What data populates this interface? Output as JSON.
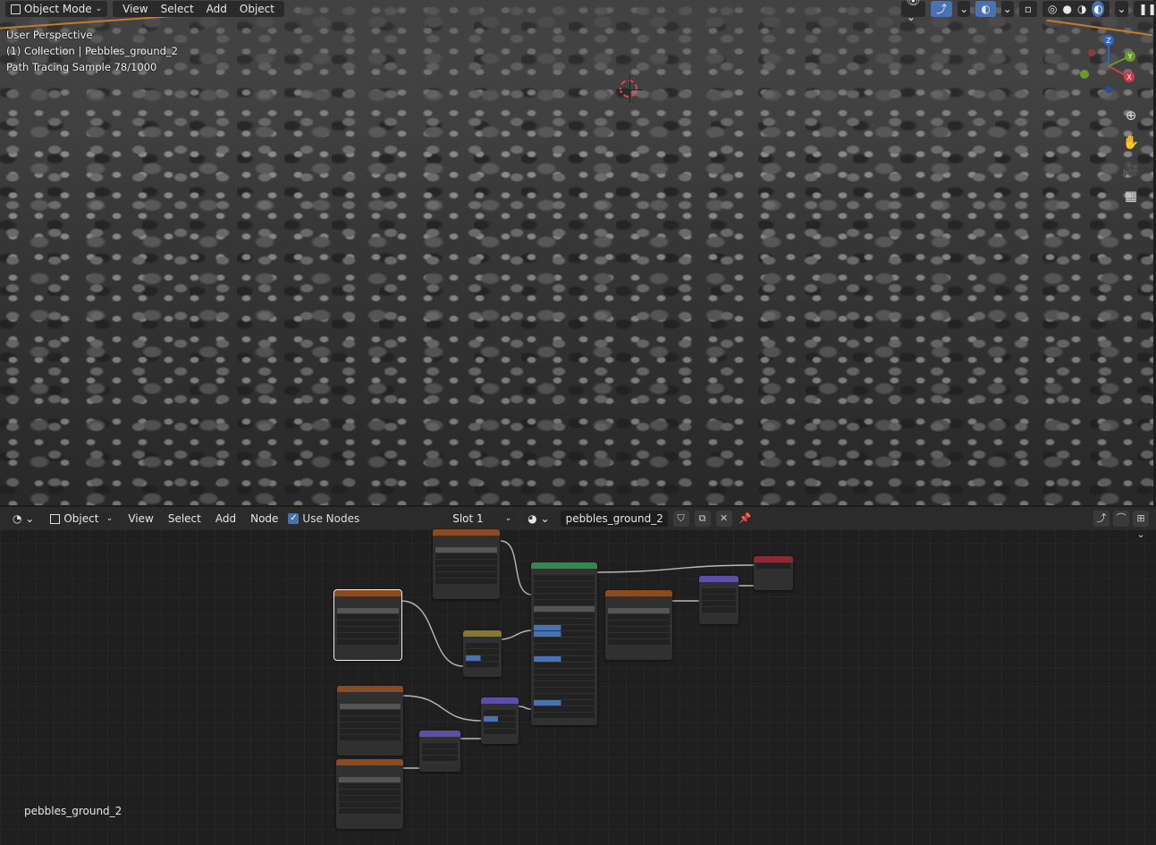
{
  "viewport": {
    "mode_label": "Object Mode",
    "menu": [
      "View",
      "Select",
      "Add",
      "Object"
    ],
    "overlay": {
      "view_name": "User Perspective",
      "collection": "(1) Collection | Pebbles_ground_2",
      "render_status": "Path Tracing Sample 78/1000"
    },
    "gizmo_axes": {
      "x": "X",
      "y": "Y",
      "z": "Z"
    }
  },
  "node_editor": {
    "header": {
      "object_label": "Object",
      "menu": [
        "View",
        "Select",
        "Add",
        "Node"
      ],
      "use_nodes_label": "Use Nodes",
      "use_nodes_checked": true,
      "slot_label": "Slot 1",
      "material_name": "pebbles_ground_2"
    },
    "material_label": "pebbles_ground_2"
  },
  "colors": {
    "texture_node": "#8a4a22",
    "shader_node": "#2e8a4e",
    "vector_node": "#5d4fa8",
    "output_node": "#8c2a33",
    "color_node": "#857a2c",
    "accent": "#4772b3"
  }
}
